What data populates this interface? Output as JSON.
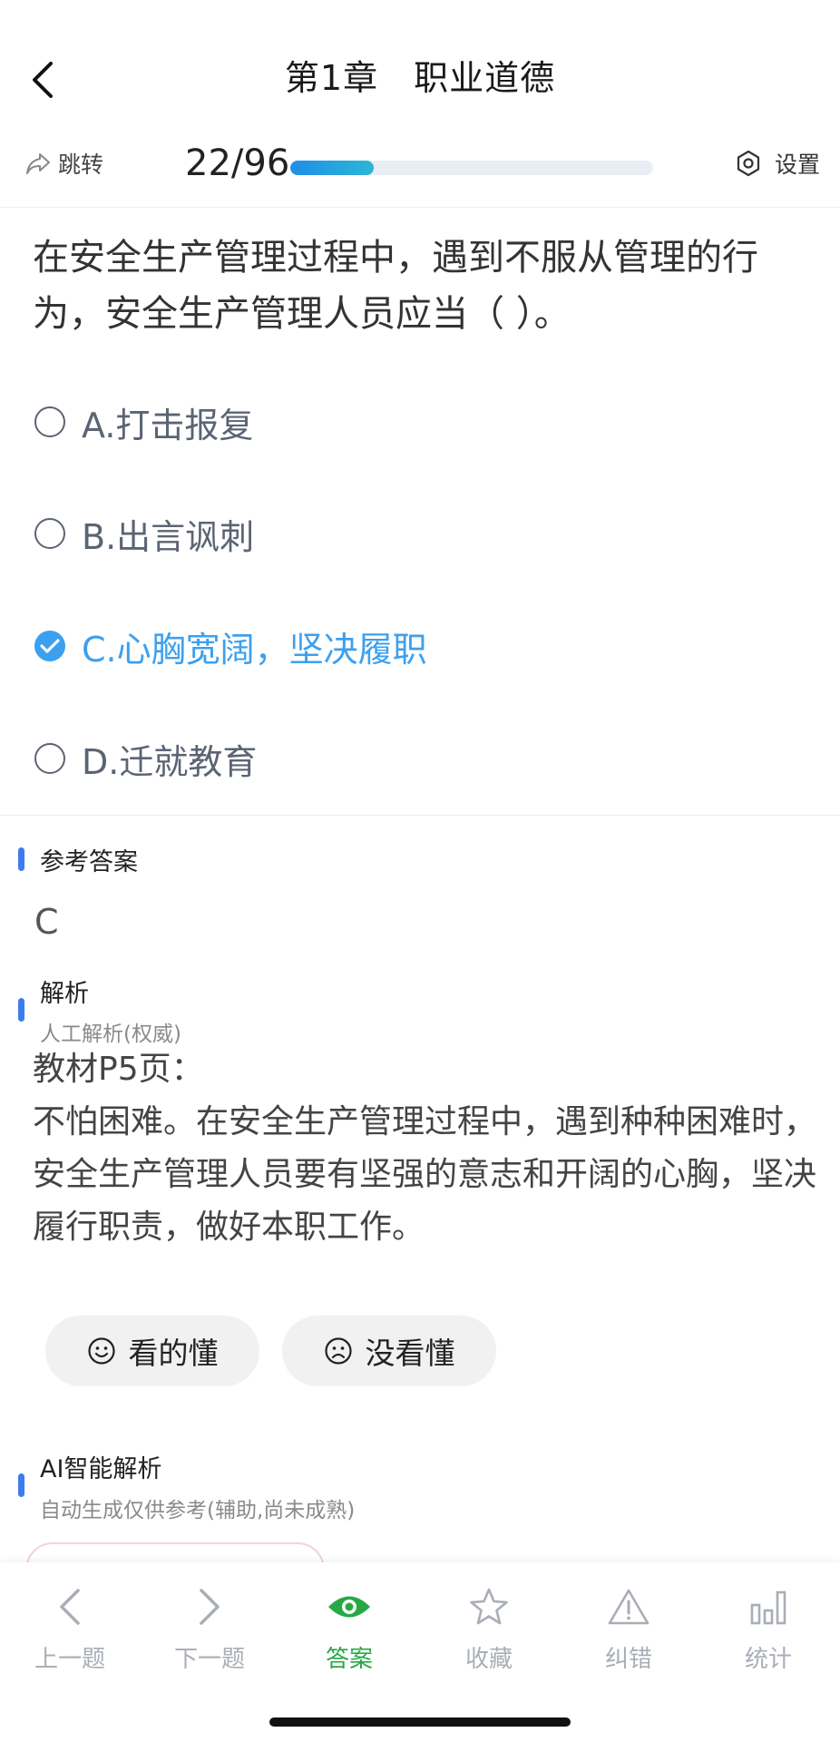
{
  "header": {
    "title": "第1章　职业道德",
    "jump_label": "跳转",
    "progress_text": "22/96",
    "progress_fraction": 0.2292,
    "settings_label": "设置"
  },
  "question": {
    "text": "在安全生产管理过程中，遇到不服从管理的行为，安全生产管理人员应当（ ）。",
    "options": [
      {
        "label": "A.打击报复",
        "selected": false
      },
      {
        "label": "B.出言讽刺",
        "selected": false
      },
      {
        "label": "C.心胸宽阔，坚决履职",
        "selected": true
      },
      {
        "label": "D.迁就教育",
        "selected": false
      }
    ]
  },
  "reference_answer": {
    "title": "参考答案",
    "value": "C"
  },
  "analysis": {
    "title": "解析",
    "subtitle": "人工解析(权威)",
    "line1": "教材P5页：",
    "line2": "不怕困难。在安全生产管理过程中，遇到种种困难时，安全生产管理人员要有坚强的意志和开阔的心胸，坚决履行职责，做好本职工作。",
    "understood_label": "看的懂",
    "not_understood_label": "没看懂"
  },
  "ai_analysis": {
    "title": "AI智能解析",
    "subtitle": "自动生成仅供参考(辅助,尚未成熟)"
  },
  "bottom_nav": {
    "items": [
      {
        "label": "上一题",
        "icon": "chevron-left-icon",
        "active": false
      },
      {
        "label": "下一题",
        "icon": "chevron-right-icon",
        "active": false
      },
      {
        "label": "答案",
        "icon": "eye-icon",
        "active": true
      },
      {
        "label": "收藏",
        "icon": "star-icon",
        "active": false
      },
      {
        "label": "纠错",
        "icon": "warning-icon",
        "active": false
      },
      {
        "label": "统计",
        "icon": "bar-chart-icon",
        "active": false
      }
    ]
  },
  "colors": {
    "accent_blue": "#3ca0ef",
    "active_green": "#27a845",
    "section_bar": "#3d7cf0"
  }
}
